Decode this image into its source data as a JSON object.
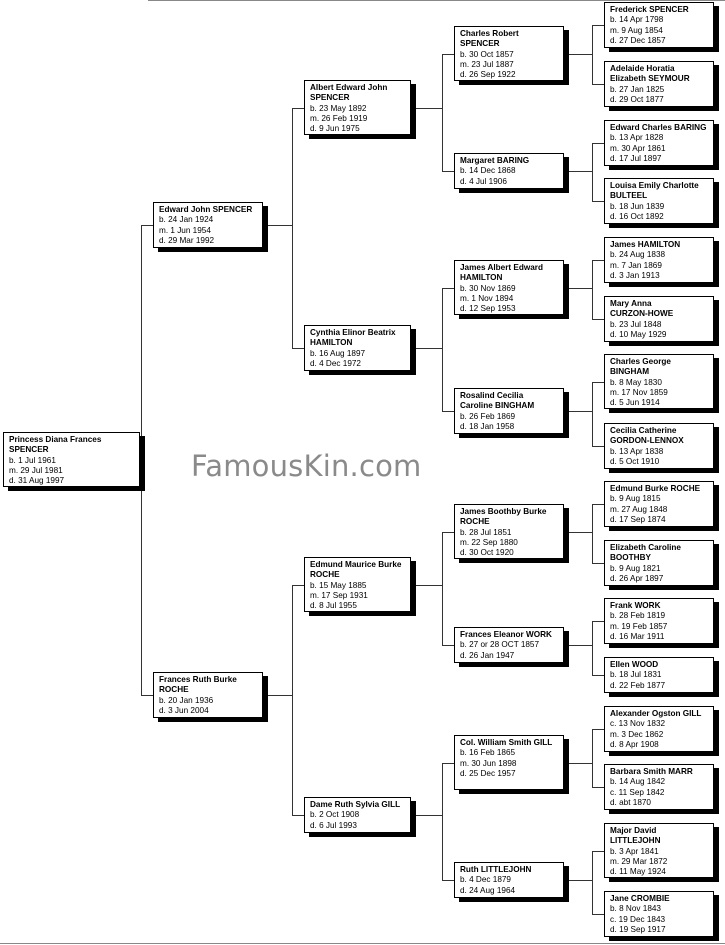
{
  "watermark": "FamousKin.com",
  "people": [
    {
      "id": "p0",
      "name": [
        "Princess Diana Frances",
        "SPENCER"
      ],
      "events": [
        "b. 1 Jul 1961",
        "m. 29 Jul 1981",
        "d. 31 Aug 1997"
      ]
    },
    {
      "id": "p1",
      "name": [
        "Edward John SPENCER"
      ],
      "events": [
        "b. 24 Jan 1924",
        "m. 1 Jun 1954",
        "d. 29 Mar 1992"
      ]
    },
    {
      "id": "p2",
      "name": [
        "Frances Ruth Burke",
        "ROCHE"
      ],
      "events": [
        "b. 20 Jan 1936",
        "d. 3 Jun 2004"
      ]
    },
    {
      "id": "p3",
      "name": [
        "Albert Edward John",
        "SPENCER"
      ],
      "events": [
        "b. 23 May 1892",
        "m. 26 Feb 1919",
        "d. 9 Jun 1975"
      ]
    },
    {
      "id": "p4",
      "name": [
        "Cynthia Elinor Beatrix",
        "HAMILTON"
      ],
      "events": [
        "b. 16 Aug 1897",
        "d. 4 Dec 1972"
      ]
    },
    {
      "id": "p5",
      "name": [
        "Edmund Maurice Burke",
        "ROCHE"
      ],
      "events": [
        "b. 15 May 1885",
        "m. 17 Sep 1931",
        "d. 8 Jul 1955"
      ]
    },
    {
      "id": "p6",
      "name": [
        "Dame Ruth Sylvia GILL"
      ],
      "events": [
        "b. 2 Oct 1908",
        "d. 6 Jul 1993"
      ]
    },
    {
      "id": "p7",
      "name": [
        "Charles Robert",
        "SPENCER"
      ],
      "events": [
        "b. 30 Oct 1857",
        "m. 23 Jul 1887",
        "d. 26 Sep 1922"
      ]
    },
    {
      "id": "p8",
      "name": [
        "Margaret BARING"
      ],
      "events": [
        "b. 14 Dec 1868",
        "d. 4 Jul 1906"
      ]
    },
    {
      "id": "p9",
      "name": [
        "James Albert Edward",
        "HAMILTON"
      ],
      "events": [
        "b. 30 Nov 1869",
        "m. 1 Nov 1894",
        "d. 12 Sep 1953"
      ]
    },
    {
      "id": "p10",
      "name": [
        "Rosalind Cecilia",
        "Caroline BINGHAM"
      ],
      "events": [
        "b. 26 Feb 1869",
        "d. 18 Jan 1958"
      ]
    },
    {
      "id": "p11",
      "name": [
        "James Boothby Burke",
        "ROCHE"
      ],
      "events": [
        "b. 28 Jul 1851",
        "m. 22 Sep 1880",
        "d. 30 Oct 1920"
      ]
    },
    {
      "id": "p12",
      "name": [
        "Frances Eleanor WORK"
      ],
      "events": [
        "b. 27 or 28 OCT 1857",
        "d. 26 Jan 1947"
      ]
    },
    {
      "id": "p13",
      "name": [
        "Col. William Smith GILL"
      ],
      "events": [
        "b. 16 Feb 1865",
        "m. 30 Jun 1898",
        "d. 25 Dec 1957"
      ]
    },
    {
      "id": "p14",
      "name": [
        "Ruth LITTLEJOHN"
      ],
      "events": [
        "b. 4 Dec 1879",
        "d. 24 Aug 1964"
      ]
    },
    {
      "id": "p15",
      "name": [
        "Frederick SPENCER"
      ],
      "events": [
        "b. 14 Apr 1798",
        "m. 9 Aug 1854",
        "d. 27 Dec 1857"
      ]
    },
    {
      "id": "p16",
      "name": [
        "Adelaide Horatia",
        "Elizabeth SEYMOUR"
      ],
      "events": [
        "b. 27 Jan 1825",
        "d. 29 Oct 1877"
      ]
    },
    {
      "id": "p17",
      "name": [
        "Edward Charles BARING"
      ],
      "events": [
        "b. 13 Apr 1828",
        "m. 30 Apr 1861",
        "d. 17 Jul 1897"
      ]
    },
    {
      "id": "p18",
      "name": [
        "Louisa Emily Charlotte",
        "BULTEEL"
      ],
      "events": [
        "b. 18 Jun 1839",
        "d. 16 Oct 1892"
      ]
    },
    {
      "id": "p19",
      "name": [
        "James HAMILTON"
      ],
      "events": [
        "b. 24 Aug 1838",
        "m. 7 Jan 1869",
        "d. 3 Jan 1913"
      ]
    },
    {
      "id": "p20",
      "name": [
        "Mary Anna",
        "CURZON-HOWE"
      ],
      "events": [
        "b. 23 Jul 1848",
        "d. 10 May 1929"
      ]
    },
    {
      "id": "p21",
      "name": [
        "Charles George",
        "BINGHAM"
      ],
      "events": [
        "b. 8 May 1830",
        "m. 17 Nov 1859",
        "d. 5 Jun 1914"
      ]
    },
    {
      "id": "p22",
      "name": [
        "Cecilia Catherine",
        "GORDON-LENNOX"
      ],
      "events": [
        "b. 13 Apr 1838",
        "d. 5 Oct 1910"
      ]
    },
    {
      "id": "p23",
      "name": [
        "Edmund Burke ROCHE"
      ],
      "events": [
        "b. 9 Aug 1815",
        "m. 27 Aug 1848",
        "d. 17 Sep 1874"
      ]
    },
    {
      "id": "p24",
      "name": [
        "Elizabeth Caroline",
        "BOOTHBY"
      ],
      "events": [
        "b. 9 Aug 1821",
        "d. 26 Apr 1897"
      ]
    },
    {
      "id": "p25",
      "name": [
        "Frank WORK"
      ],
      "events": [
        "b. 28 Feb 1819",
        "m. 19 Feb 1857",
        "d. 16 Mar 1911"
      ]
    },
    {
      "id": "p26",
      "name": [
        "Ellen WOOD"
      ],
      "events": [
        "b. 18 Jul 1831",
        "d. 22 Feb 1877"
      ]
    },
    {
      "id": "p27",
      "name": [
        "Alexander Ogston GILL"
      ],
      "events": [
        "c. 13 Nov 1832",
        "m. 3 Dec 1862",
        "d. 8 Apr 1908"
      ]
    },
    {
      "id": "p28",
      "name": [
        "Barbara Smith MARR"
      ],
      "events": [
        "b. 14 Aug 1842",
        "c. 11 Sep 1842",
        "d. abt 1870"
      ]
    },
    {
      "id": "p29",
      "name": [
        "Major David",
        "LITTLEJOHN"
      ],
      "events": [
        "b. 3 Apr 1841",
        "m. 29 Mar 1872",
        "d. 11 May 1924"
      ]
    },
    {
      "id": "p30",
      "name": [
        "Jane CROMBIE"
      ],
      "events": [
        "b. 8 Nov 1843",
        "c. 19 Dec 1843",
        "d. 19 Sep 1917"
      ]
    }
  ]
}
